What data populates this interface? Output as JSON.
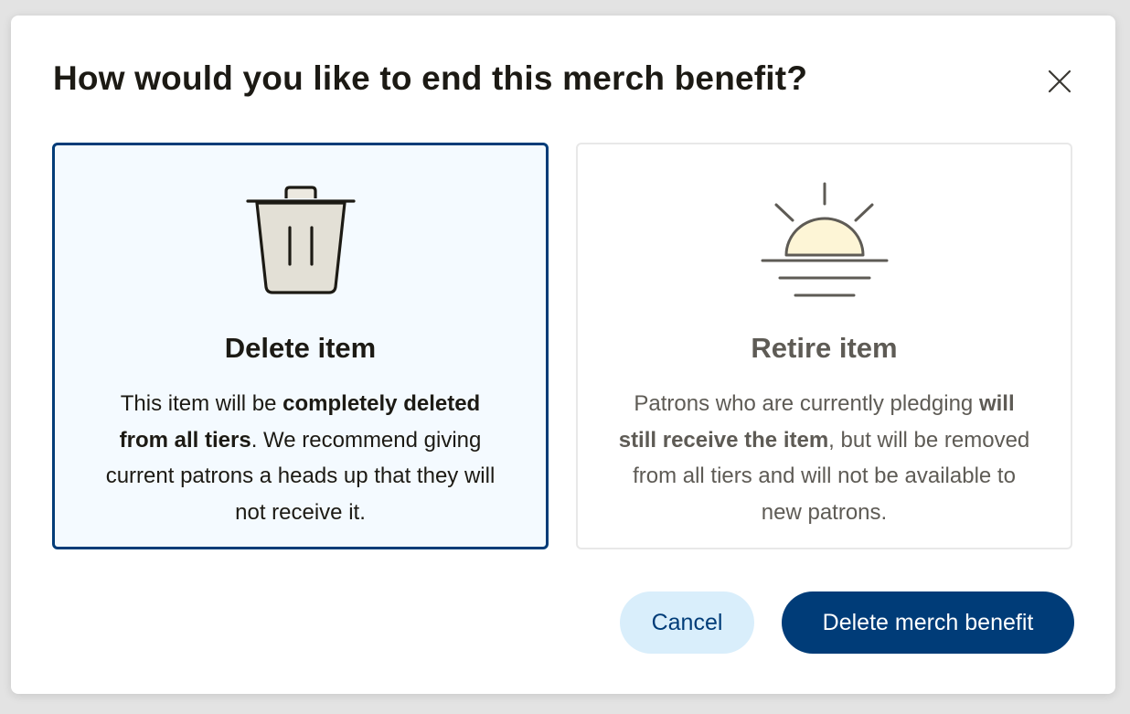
{
  "dialog": {
    "title": "How would you like to end this merch benefit?",
    "close_icon": "close-icon"
  },
  "options": {
    "delete": {
      "icon": "trash-can-icon",
      "title": "Delete item",
      "desc_part1": "This item will be ",
      "desc_bold": "completely deleted from all tiers",
      "desc_part2": ". We recommend giving current patrons a heads up that they will not receive it.",
      "selected": true
    },
    "retire": {
      "icon": "sunset-icon",
      "title": "Retire item",
      "desc_part1": "Patrons who are currently pledging ",
      "desc_bold": "will still receive the item",
      "desc_part2": ", but will be removed from all tiers and will not be available to new patrons.",
      "selected": false
    }
  },
  "actions": {
    "cancel_label": "Cancel",
    "confirm_label": "Delete merch benefit"
  },
  "colors": {
    "primary": "#003c78",
    "selected_card_bg": "#f4faff",
    "secondary_button_bg": "#d9eefb",
    "sun_fill": "#fdf5d6"
  }
}
